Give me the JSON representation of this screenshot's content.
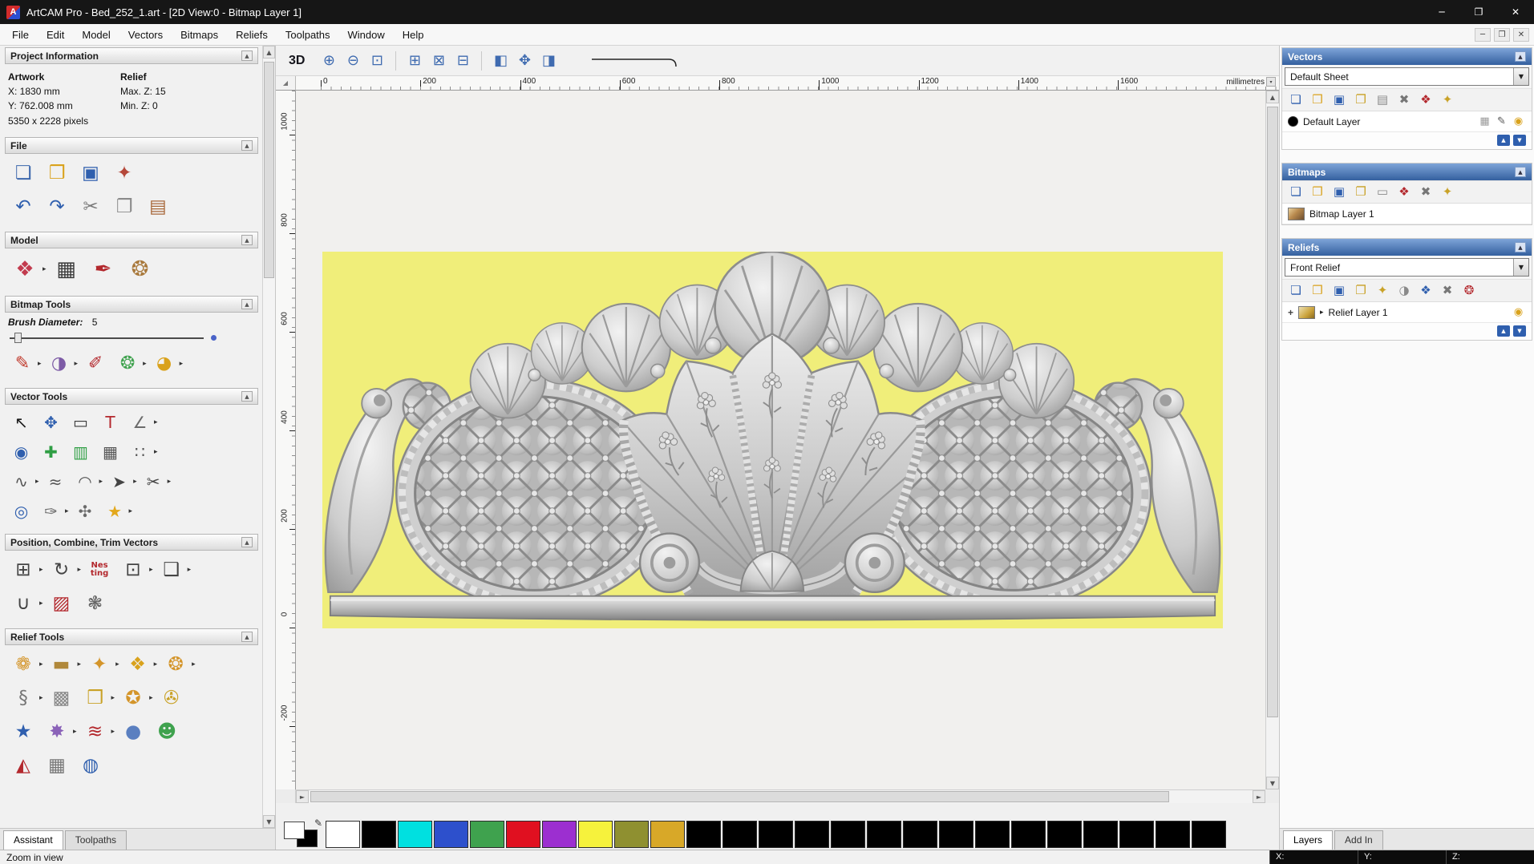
{
  "window": {
    "title": "ArtCAM Pro - Bed_252_1.art - [2D View:0 - Bitmap Layer 1]",
    "app_initial": "A",
    "controls": [
      {
        "n": "minimize-button",
        "g": "─"
      },
      {
        "n": "maximize-button",
        "g": "❐"
      },
      {
        "n": "close-button",
        "g": "✕"
      }
    ]
  },
  "menu_bar": {
    "items": [
      "File",
      "Edit",
      "Model",
      "Vectors",
      "Bitmaps",
      "Reliefs",
      "Toolpaths",
      "Window",
      "Help"
    ],
    "mdi_controls": [
      {
        "n": "mdi-minimize-button",
        "g": "─"
      },
      {
        "n": "mdi-restore-button",
        "g": "❐"
      },
      {
        "n": "mdi-close-button",
        "g": "✕"
      }
    ]
  },
  "scrollbar": {
    "up": "▲",
    "down": "▼",
    "left": "◄",
    "right": "►",
    "corner_glyph": "◢"
  },
  "left_panel": {
    "project_info": {
      "title": "Project Information",
      "artwork_heading": "Artwork",
      "relief_heading": "Relief",
      "x_value": "X: 1830 mm",
      "y_value": "Y: 762.008 mm",
      "max_z": "Max. Z: 15",
      "min_z": "Min. Z: 0",
      "pixels": "5350 x 2228 pixels"
    },
    "file_section": {
      "title": "File",
      "rows": [
        [
          {
            "n": "new-model-icon",
            "g": "❏",
            "c": "#3e68ad"
          },
          {
            "n": "open-model-icon",
            "g": "❒",
            "c": "#d9a21c"
          },
          {
            "n": "save-model-icon",
            "g": "▣",
            "c": "#2f5fae"
          },
          {
            "n": "export-model-icon",
            "g": "✦",
            "c": "#b5483a"
          }
        ],
        [
          {
            "n": "undo-icon",
            "g": "↶",
            "c": "#2f5fae"
          },
          {
            "n": "redo-icon",
            "g": "↷",
            "c": "#2f5fae"
          },
          {
            "n": "cut-icon",
            "g": "✂",
            "c": "#7a7a7a"
          },
          {
            "n": "copy-icon",
            "g": "❐",
            "c": "#8a8a8a"
          },
          {
            "n": "paste-icon",
            "g": "▤",
            "c": "#a8683a"
          }
        ]
      ]
    },
    "model_section": {
      "title": "Model",
      "rows": [
        [
          {
            "n": "set-model-size-icon",
            "g": "❖",
            "c": "#c23b4e",
            "f": true
          },
          {
            "n": "greyscale-view-icon",
            "g": "▦",
            "c": "#3a3a3a"
          },
          {
            "n": "sculpt-model-icon",
            "g": "✒",
            "c": "#b3282d"
          },
          {
            "n": "material-icon",
            "g": "❂",
            "c": "#a9793c"
          }
        ]
      ]
    },
    "bitmap_section": {
      "title": "Bitmap Tools",
      "brush_label": "Brush Diameter:",
      "brush_value": "5",
      "rows": [
        [
          {
            "n": "paint-icon",
            "g": "✎",
            "c": "#c0392b",
            "f": true
          },
          {
            "n": "paint-selective-icon",
            "g": "◑",
            "c": "#7d5ba6",
            "f": true
          },
          {
            "n": "pick-colour-icon",
            "g": "✐",
            "c": "#b3282d"
          },
          {
            "n": "colour-palette-icon",
            "g": "❂",
            "c": "#3fa24e",
            "f": true
          },
          {
            "n": "flood-fill-icon",
            "g": "◕",
            "c": "#d9a21c",
            "f": true
          }
        ]
      ]
    },
    "vector_section": {
      "title": "Vector Tools",
      "rows": [
        [
          {
            "n": "select-vectors-icon",
            "g": "↖",
            "c": "#1c1c1c"
          },
          {
            "n": "transform-vectors-icon",
            "g": "✥",
            "c": "#2f5fae"
          },
          {
            "n": "create-rectangle-icon",
            "g": "▭",
            "c": "#3a3a3a"
          },
          {
            "n": "create-text-icon",
            "g": "T",
            "c": "#b3282d"
          },
          {
            "n": "measure-icon",
            "g": "∠",
            "c": "#6b6b6b",
            "f": true
          }
        ],
        [
          {
            "n": "create-circle-icon",
            "g": "◉",
            "c": "#2f5fae"
          },
          {
            "n": "paste-along-curve-icon",
            "g": "✚",
            "c": "#2f9e44"
          },
          {
            "n": "text-table-icon",
            "g": "▥",
            "c": "#2f9e44"
          },
          {
            "n": "grid-guides-icon",
            "g": "▦",
            "c": "#555555"
          },
          {
            "n": "snap-points-icon",
            "g": "∷",
            "c": "#555555",
            "f": true
          }
        ],
        [
          {
            "n": "create-polyline-icon",
            "g": "∿",
            "c": "#555555",
            "f": true
          },
          {
            "n": "fit-curve-icon",
            "g": "≈",
            "c": "#555555"
          },
          {
            "n": "create-arc-icon",
            "g": "◠",
            "c": "#555555",
            "f": true
          },
          {
            "n": "extend-vector-icon",
            "g": "➤",
            "c": "#444444",
            "f": true
          },
          {
            "n": "trim-vectors-icon",
            "g": "✂",
            "c": "#444444",
            "f": true
          }
        ],
        [
          {
            "n": "fillet-icon",
            "g": "◎",
            "c": "#2f5fae"
          },
          {
            "n": "vector-doctor-icon",
            "g": "✑",
            "c": "#6b6b6b",
            "f": true
          },
          {
            "n": "join-vectors-icon",
            "g": "✣",
            "c": "#6b6b6b"
          },
          {
            "n": "create-star-icon",
            "g": "★",
            "c": "#e3a81c",
            "f": true
          }
        ]
      ]
    },
    "position_section": {
      "title": "Position, Combine, Trim Vectors",
      "rows": [
        [
          {
            "n": "block-copy-icon",
            "g": "⊞",
            "c": "#444444",
            "f": true
          },
          {
            "n": "rotate-copy-icon",
            "g": "↻",
            "c": "#444444",
            "f": true
          },
          {
            "n": "nesting-icon",
            "t": "Nes\nting"
          },
          {
            "n": "align-vectors-icon",
            "g": "⊡",
            "c": "#444444",
            "f": true
          },
          {
            "n": "group-vectors-icon",
            "g": "❑",
            "c": "#444444",
            "f": true
          }
        ],
        [
          {
            "n": "fit-vectors-icon",
            "g": "∪",
            "c": "#444444",
            "f": true
          },
          {
            "n": "fluting-icon",
            "g": "▨",
            "c": "#b3282d"
          },
          {
            "n": "spiral-icon",
            "g": "❃",
            "c": "#666666"
          }
        ]
      ]
    },
    "relief_section": {
      "title": "Relief Tools",
      "rows": [
        [
          {
            "n": "shape-editor-icon",
            "g": "❁",
            "c": "#d4952a",
            "f": true
          },
          {
            "n": "smooth-relief-icon",
            "g": "▬",
            "c": "#b0883a",
            "f": true
          },
          {
            "n": "sculpting-icon",
            "g": "✦",
            "c": "#d4952a",
            "f": true
          },
          {
            "n": "swept-profile-icon",
            "g": "❖",
            "c": "#d9a21c",
            "f": true
          },
          {
            "n": "two-rail-sweep-icon",
            "g": "❂",
            "c": "#d4952a",
            "f": true
          }
        ],
        [
          {
            "n": "isoform-icon",
            "g": "§",
            "c": "#777777",
            "f": true
          },
          {
            "n": "weave-wizard-icon",
            "g": "▩",
            "c": "#888888"
          },
          {
            "n": "offset-relief-icon",
            "g": "❒",
            "c": "#c9a227",
            "f": true
          },
          {
            "n": "extrude-icon",
            "g": "✪",
            "c": "#d4952a",
            "f": true
          },
          {
            "n": "constant-height-icon",
            "g": "✇",
            "c": "#c9a227"
          }
        ],
        [
          {
            "n": "star-wizard-icon",
            "g": "★",
            "c": "#2f5fae"
          },
          {
            "n": "texture-relief-icon",
            "g": "✸",
            "c": "#8a62b8",
            "f": true
          },
          {
            "n": "turn-wizard-icon",
            "g": "≋",
            "c": "#b3282d",
            "f": true
          },
          {
            "n": "dome-wizard-icon",
            "g": "●",
            "c": "#5a7fc0"
          },
          {
            "n": "face-wizard-icon",
            "g": "☻",
            "c": "#3fa24e"
          }
        ],
        [
          {
            "n": "angled-plane-icon",
            "g": "◭",
            "c": "#b3282d"
          },
          {
            "n": "mesh-relief-icon",
            "g": "▦",
            "c": "#777777"
          },
          {
            "n": "wrap-relief-icon",
            "g": "◍",
            "c": "#2f5fae"
          }
        ]
      ]
    },
    "tabs": [
      {
        "label": "Assistant",
        "active": true
      },
      {
        "label": "Toolpaths",
        "active": false
      }
    ]
  },
  "canvas": {
    "toolbar": {
      "view_3d_label": "3D",
      "groups": [
        [
          {
            "n": "zoom-in-icon",
            "g": "⊕"
          },
          {
            "n": "zoom-out-icon",
            "g": "⊖"
          },
          {
            "n": "zoom-window-icon",
            "g": "⊡"
          }
        ],
        [
          {
            "n": "zoom-fit-icon",
            "g": "⊞"
          },
          {
            "n": "zoom-selected-icon",
            "g": "⊠"
          },
          {
            "n": "zoom-actual-icon",
            "g": "⊟"
          }
        ],
        [
          {
            "n": "previous-view-icon",
            "g": "◧"
          },
          {
            "n": "pan-view-icon",
            "g": "✥"
          },
          {
            "n": "snap-grid-icon",
            "g": "◨"
          }
        ]
      ]
    },
    "ruler": {
      "units_label": "millimetres",
      "h_ticks": [
        0,
        200,
        400,
        600,
        800,
        1000,
        1200,
        1400,
        1600
      ],
      "v_ticks": [
        1000,
        800,
        600,
        400,
        200,
        0,
        -200
      ]
    },
    "artwork": {
      "background": "#f0ee7a"
    }
  },
  "palette": {
    "swatches": [
      "#ffffff",
      "#000000",
      "#00e0e0",
      "#2d50cc",
      "#3fa24e",
      "#e01020",
      "#9c2fd0",
      "#f6f23c",
      "#8f9030",
      "#d8a828",
      "#000000",
      "#000000",
      "#000000",
      "#000000",
      "#000000",
      "#000000",
      "#000000",
      "#000000",
      "#000000",
      "#000000",
      "#000000",
      "#000000",
      "#000000",
      "#000000",
      "#000000"
    ]
  },
  "right_panel": {
    "vectors": {
      "title": "Vectors",
      "sheet_value": "Default Sheet",
      "toolbar": [
        {
          "n": "new-sheet-icon",
          "g": "❏",
          "c": "#2f5fae"
        },
        {
          "n": "open-sheet-icon",
          "g": "❒",
          "c": "#d9a21c"
        },
        {
          "n": "save-sheet-icon",
          "g": "▣",
          "c": "#2f5fae"
        },
        {
          "n": "import-vectors-icon",
          "g": "❐",
          "c": "#c9a227"
        },
        {
          "n": "merge-layers-icon",
          "g": "▤",
          "c": "#8a8a8a"
        },
        {
          "n": "delete-layer-icon",
          "g": "✖",
          "c": "#777777"
        },
        {
          "n": "show-all-layers-icon",
          "g": "❖",
          "c": "#b3282d"
        },
        {
          "n": "new-vector-layer-icon",
          "g": "✦",
          "c": "#c9a227"
        }
      ],
      "layer_name": "Default Layer",
      "layer_icons": [
        {
          "n": "layer-snap-icon",
          "g": "▦",
          "c": "#9a9a9a"
        },
        {
          "n": "layer-edit-icon",
          "g": "✎",
          "c": "#555555"
        },
        {
          "n": "layer-visibility-icon",
          "g": "◉",
          "c": "#d9a21c"
        }
      ],
      "updown": [
        {
          "n": "move-layer-up-button",
          "g": "▲"
        },
        {
          "n": "move-layer-down-button",
          "g": "▼"
        }
      ]
    },
    "bitmaps": {
      "title": "Bitmaps",
      "toolbar": [
        {
          "n": "new-bitmap-icon",
          "g": "❏",
          "c": "#2f5fae"
        },
        {
          "n": "open-bitmap-icon",
          "g": "❒",
          "c": "#d9a21c"
        },
        {
          "n": "save-bitmap-icon",
          "g": "▣",
          "c": "#2f5fae"
        },
        {
          "n": "import-bitmap-icon",
          "g": "❐",
          "c": "#c9a227"
        },
        {
          "n": "greyscale-bitmap-icon",
          "g": "▭",
          "c": "#8a8a8a"
        },
        {
          "n": "bitmap-to-vector-icon",
          "g": "❖",
          "c": "#b3282d"
        },
        {
          "n": "delete-bitmap-icon",
          "g": "✖",
          "c": "#777777"
        },
        {
          "n": "transfer-bitmap-icon",
          "g": "✦",
          "c": "#c9a227"
        }
      ],
      "layer_name": "Bitmap Layer 1"
    },
    "reliefs": {
      "title": "Reliefs",
      "relief_value": "Front Relief",
      "toolbar": [
        {
          "n": "new-relief-icon",
          "g": "❏",
          "c": "#2f5fae"
        },
        {
          "n": "open-relief-icon",
          "g": "❒",
          "c": "#d9a21c"
        },
        {
          "n": "save-relief-icon",
          "g": "▣",
          "c": "#2f5fae"
        },
        {
          "n": "import-relief-icon",
          "g": "❐",
          "c": "#c9a227"
        },
        {
          "n": "smooth-relief-layer-icon",
          "g": "✦",
          "c": "#c9a227"
        },
        {
          "n": "invert-relief-icon",
          "g": "◑",
          "c": "#8a8a8a"
        },
        {
          "n": "scale-relief-icon",
          "g": "❖",
          "c": "#2f5fae"
        },
        {
          "n": "delete-relief-icon",
          "g": "✖",
          "c": "#777777"
        },
        {
          "n": "transfer-relief-icon",
          "g": "❂",
          "c": "#b3282d"
        }
      ],
      "layer_name": "Relief Layer 1",
      "layer_expander": "▸",
      "layer_plus": "+",
      "layer_icons": [
        {
          "n": "relief-visibility-icon",
          "g": "◉",
          "c": "#d9a21c"
        }
      ],
      "updown": [
        {
          "n": "move-relief-up-button",
          "g": "▲"
        },
        {
          "n": "move-relief-down-button",
          "g": "▼"
        }
      ]
    },
    "tabs": [
      {
        "label": "Layers",
        "active": true
      },
      {
        "label": "Add In",
        "active": false
      }
    ]
  },
  "status_bar": {
    "message": "Zoom in view",
    "coord_labels": [
      "X:",
      "Y:",
      "Z:"
    ]
  }
}
